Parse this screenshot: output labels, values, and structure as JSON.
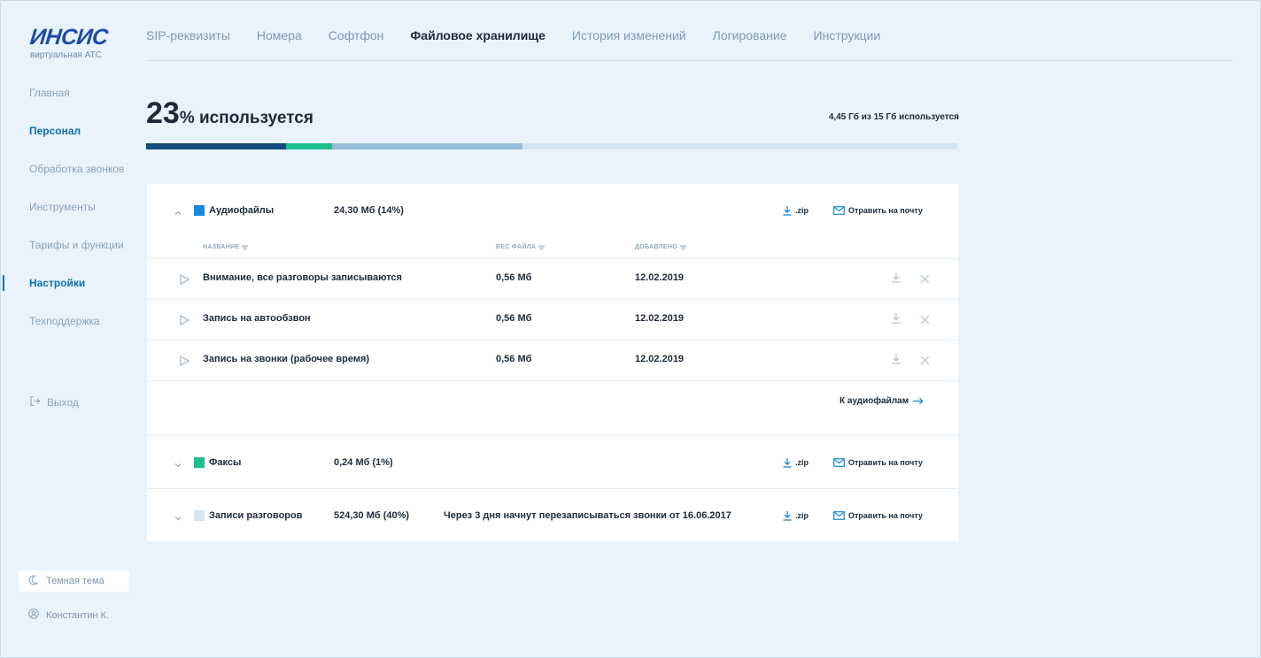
{
  "brand": {
    "logo_text_a": "ИН",
    "logo_text_b": "СИС",
    "subtitle": "виртуальная АТС",
    "accent": "#0f6fb3"
  },
  "sidebar": {
    "items": [
      {
        "label": "Главная"
      },
      {
        "label": "Персонал"
      },
      {
        "label": "Обработка звонков"
      },
      {
        "label": "Инструменты"
      },
      {
        "label": "Тарифы и функции"
      },
      {
        "label": "Настройки"
      },
      {
        "label": "Техподдержка"
      }
    ],
    "logout": "Выход",
    "theme": "Темная тема",
    "user": "Константин К."
  },
  "tabs": [
    {
      "label": "SIP-реквизиты"
    },
    {
      "label": "Номера"
    },
    {
      "label": "Софтфон"
    },
    {
      "label": "Файловое хранилище"
    },
    {
      "label": "История изменений"
    },
    {
      "label": "Логирование"
    },
    {
      "label": "Инструкции"
    }
  ],
  "usage": {
    "percent": "23",
    "label": "% используется",
    "meta": "4,45 Гб из 15 Гб используется",
    "segments": [
      {
        "fraction": 0.172,
        "color": "#134a7c"
      },
      {
        "fraction": 0.057,
        "color": "#1cc08e"
      },
      {
        "fraction": 0.235,
        "color": "#97bcd9"
      }
    ],
    "track_color": "#d3e4f3"
  },
  "sections": {
    "audio": {
      "name": "Аудиофайлы",
      "size": "24,30 Мб (14%)",
      "color": "#1489e0",
      "zip": ".zip",
      "mail": "Отравить на почту",
      "columns": {
        "name": "НАЗВАНИЕ",
        "size": "ВЕС ФАЙЛА",
        "date": "ДОБАВЛЕНО"
      },
      "files": [
        {
          "name": "Внимание, все разговоры записываются",
          "size": "0,56 Мб",
          "date": "12.02.2019"
        },
        {
          "name": "Запись на автообзвон",
          "size": "0,56 Мб",
          "date": "12.02.2019"
        },
        {
          "name": "Запись на звонки (рабочее  время)",
          "size": "0,56 Мб",
          "date": "12.02.2019"
        }
      ],
      "goto": "К аудиофайлам"
    },
    "fax": {
      "name": "Факсы",
      "size": "0,24 Мб (1%)",
      "color": "#1cc08e",
      "zip": ".zip",
      "mail": "Отравить на почту"
    },
    "calls": {
      "name": "Записи разговоров",
      "size": "524,30 Мб (40%)",
      "note": "Через 3 дня начнут перезаписываться звонки от 16.06.2017",
      "color": "#d3e4f3",
      "zip": ".zip",
      "mail": "Отравить на почту"
    }
  }
}
